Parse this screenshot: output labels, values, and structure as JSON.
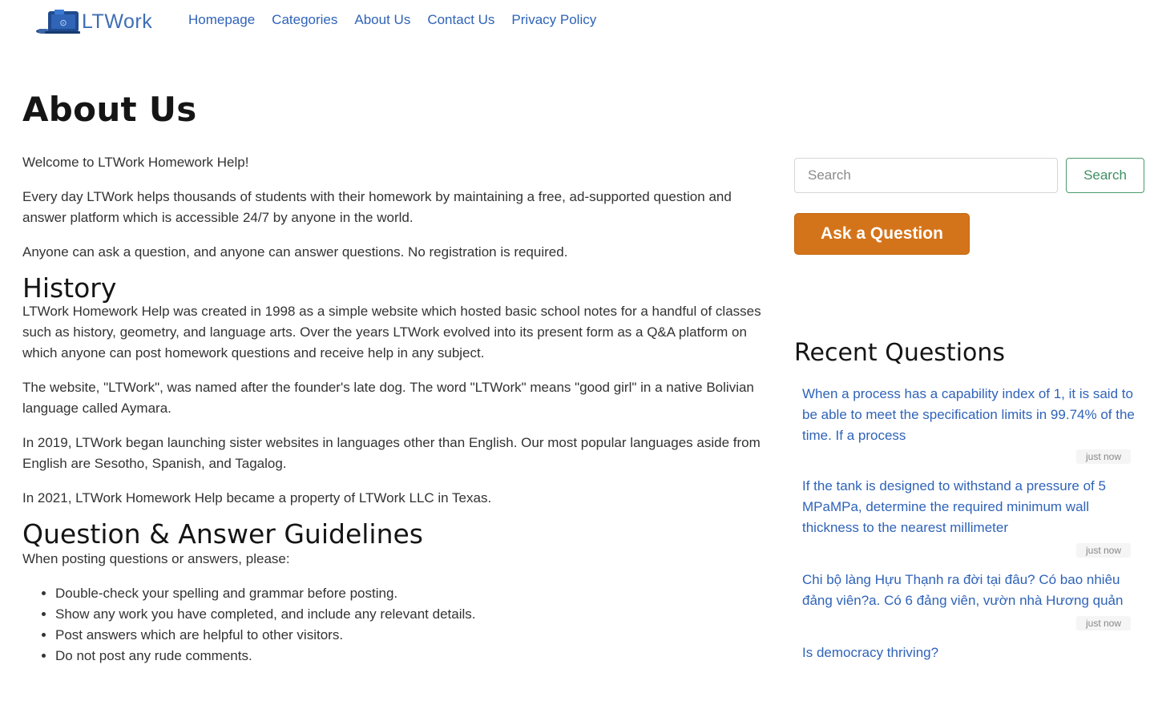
{
  "header": {
    "logo_text": "LTWork",
    "nav": [
      "Homepage",
      "Categories",
      "About Us",
      "Contact Us",
      "Privacy Policy"
    ]
  },
  "main": {
    "title": "About Us",
    "intro": [
      "Welcome to LTWork Homework Help!",
      "Every day LTWork helps thousands of students with their homework by maintaining a free, ad-supported question and answer platform which is accessible 24/7 by anyone in the world.",
      "Anyone can ask a question, and anyone can answer questions. No registration is required."
    ],
    "history": {
      "heading": "History",
      "paragraphs": [
        "LTWork Homework Help was created in 1998 as a simple website which hosted basic school notes for a handful of classes such as history, geometry, and language arts. Over the years LTWork evolved into its present form as a Q&A platform on which anyone can post homework questions and receive help in any subject.",
        "The website, \"LTWork\", was named after the founder's late dog. The word \"LTWork\" means \"good girl\" in a native Bolivian language called Aymara.",
        "In 2019, LTWork began launching sister websites in languages other than English. Our most popular languages aside from English are Sesotho, Spanish, and Tagalog.",
        "In 2021, LTWork Homework Help became a property of LTWork LLC in Texas."
      ]
    },
    "guidelines": {
      "heading": "Question & Answer Guidelines",
      "intro": "When posting questions or answers, please:",
      "items": [
        "Double-check your spelling and grammar before posting.",
        "Show any work you have completed, and include any relevant details.",
        "Post answers which are helpful to other visitors.",
        "Do not post any rude comments."
      ]
    }
  },
  "sidebar": {
    "search_placeholder": "Search",
    "search_button": "Search",
    "ask_button": "Ask a Question",
    "recent_title": "Recent Questions",
    "recent": [
      {
        "text": "When a process has a capability index of 1, it is said to be able to meet the specification limits in 99.74% of the time. If a process",
        "time": "just now"
      },
      {
        "text": "If the tank is designed to withstand a pressure of 5 MPaMPa, determine the required minimum wall thickness to the nearest millimeter",
        "time": "just now"
      },
      {
        "text": "Chi bộ làng Hựu Thạnh ra đời tại đâu? Có bao nhiêu đảng viên?a. Có 6 đảng viên, vườn nhà Hương quản",
        "time": "just now"
      },
      {
        "text": "Is democracy thriving?",
        "time": ""
      }
    ]
  },
  "colors": {
    "link": "#2f63b8",
    "ask_button": "#d4741a",
    "search_button_border": "#4a9b6e"
  }
}
